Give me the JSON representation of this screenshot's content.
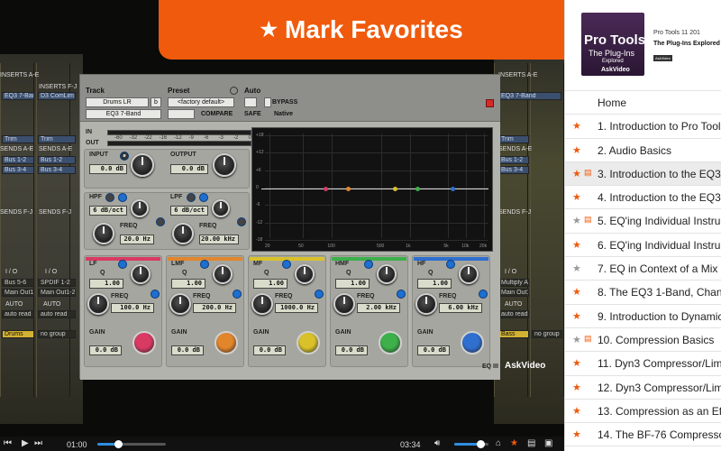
{
  "banner": {
    "label": "Mark Favorites"
  },
  "course": {
    "cover_title": "Pro Tools",
    "cover_subtitle": "The Plug-Ins",
    "cover_sub2": "Explored",
    "cover_logo": "AskVideo",
    "series": "Pro Tools 11 201",
    "title": "The Plug-Ins Explored",
    "pill": "AskVideo"
  },
  "chapters": [
    {
      "label": "Home",
      "star": "",
      "doc": false
    },
    {
      "label": "1. Introduction to Pro Tools",
      "star": "orange",
      "doc": false
    },
    {
      "label": "2. Audio Basics",
      "star": "orange",
      "doc": false
    },
    {
      "label": "3. Introduction to the EQ3",
      "star": "orange",
      "doc": true,
      "selected": true
    },
    {
      "label": "4. Introduction to the EQ3",
      "star": "orange",
      "doc": false
    },
    {
      "label": "5. EQ'ing Individual Instruments",
      "star": "grey",
      "doc": true
    },
    {
      "label": "6. EQ'ing Individual Instruments",
      "star": "orange",
      "doc": false
    },
    {
      "label": "7. EQ in Context of a Mix",
      "star": "grey",
      "doc": false
    },
    {
      "label": "8. The EQ3 1-Band, Channel",
      "star": "orange",
      "doc": false
    },
    {
      "label": "9. Introduction to Dynamics",
      "star": "orange",
      "doc": false
    },
    {
      "label": "10. Compression Basics",
      "star": "grey",
      "doc": true
    },
    {
      "label": "11. Dyn3 Compressor/Limiter",
      "star": "orange",
      "doc": false
    },
    {
      "label": "12. Dyn3 Compressor/Limiter",
      "star": "orange",
      "doc": false
    },
    {
      "label": "13. Compression as an Effect",
      "star": "orange",
      "doc": false
    },
    {
      "label": "14. The BF-76 Compressor",
      "star": "orange",
      "doc": false
    }
  ],
  "colors": {
    "orange": "#f05a0c",
    "grey": "#9a9a9a"
  },
  "plugin": {
    "track_label": "Track",
    "preset_label": "Preset",
    "auto_label": "Auto",
    "track_name": "Drums LR",
    "track_sel": "b",
    "insert": "EQ3 7-Band",
    "preset_name": "<factory default>",
    "compare": "COMPARE",
    "safe": "SAFE",
    "bypass": "BYPASS",
    "native": "Native",
    "in": "IN",
    "out": "OUT",
    "meter_scale": [
      "-60",
      "-32",
      "-22",
      "-16",
      "-12",
      "-9",
      "-6",
      "-3",
      "-2",
      "0"
    ],
    "input_label": "INPUT",
    "input_val": "0.0 dB",
    "output_label": "OUTPUT",
    "output_val": "0.0 dB",
    "hpf_label": "HPF",
    "hpf_val": "6 dB/oct",
    "hpf_freq_label": "FREQ",
    "hpf_freq": "20.0 Hz",
    "lpf_label": "LPF",
    "lpf_val": "6 dB/oct",
    "lpf_freq_label": "FREQ",
    "lpf_freq": "20.00 kHz",
    "bands": [
      {
        "name": "LF",
        "q": "1.00",
        "freq": "100.0 Hz",
        "gain": "0.0 dB",
        "color": "#d93a63"
      },
      {
        "name": "LMF",
        "q": "1.00",
        "freq": "200.0 Hz",
        "gain": "0.0 dB",
        "color": "#e2862c"
      },
      {
        "name": "MF",
        "q": "1.00",
        "freq": "1000.0 Hz",
        "gain": "0.0 dB",
        "color": "#d9c12a"
      },
      {
        "name": "HMF",
        "q": "1.00",
        "freq": "2.00 kHz",
        "gain": "0.0 dB",
        "color": "#3db04a"
      },
      {
        "name": "HF",
        "q": "1.00",
        "freq": "6.00 kHz",
        "gain": "0.0 dB",
        "color": "#2f6fd0"
      }
    ],
    "q_label": "Q",
    "freq_label": "FREQ",
    "gain_label": "GAIN",
    "eq_y_scale": [
      "+18",
      "+12",
      "+6",
      "0",
      "-6",
      "-12",
      "-18"
    ],
    "eq_x_scale": [
      "20",
      "50",
      "100",
      "500",
      "1k",
      "5k",
      "10k",
      "20k"
    ],
    "brand": "EQ III"
  },
  "mixer": {
    "left": {
      "inserts1": "INSERTS A-E",
      "inserts2": "INSERTS F-J",
      "i1": "EQ3 7-Band",
      "i2": "D3 ComLim",
      "trim": "Trim",
      "sends1": "SENDS A-E",
      "sends2": "SENDS F-J",
      "bus1": "Bus 1-2",
      "bus2": "Bus 3-4",
      "io": "I / O",
      "input": "Bus 5-6",
      "input2": "SPDIF 1-2",
      "out1": "Main Out1-2",
      "out2": "Main Out1-2",
      "auto": "AUTO",
      "auto_val": "auto read",
      "name": "Drums",
      "group": "no group"
    },
    "right": {
      "inserts1": "INSERTS A-E",
      "inserts2": "INSERTS F-J",
      "i1": "EQ3 7-Band",
      "trim": "Trim",
      "sends1": "SENDS A-E",
      "sends2": "SENDS F-J",
      "bus1": "Bus 1-2",
      "bus2": "Bus 3-4",
      "io": "I / O",
      "input": "Multiply A",
      "out1": "Main Out1-2",
      "auto": "AUTO",
      "auto_val": "auto read",
      "name": "Bass",
      "group": "no group"
    }
  },
  "watermark": "AskVideo",
  "controls": {
    "current": "01:00",
    "total": "03:34",
    "progress": 0.3,
    "volume": 0.75
  }
}
